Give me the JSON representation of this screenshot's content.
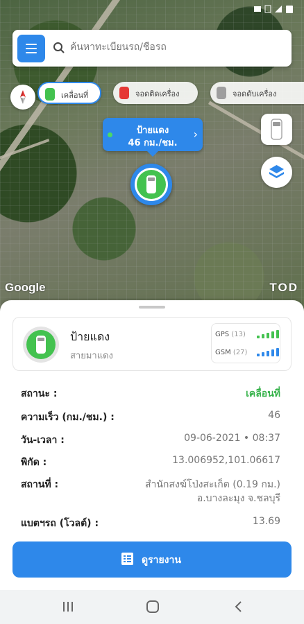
{
  "search": {
    "placeholder": "ค้นหาทะเบียนรถ/ชื่อรถ"
  },
  "filters": [
    {
      "label": "เคลื่อนที่",
      "color": "#43c24f",
      "active": true
    },
    {
      "label": "จอดติดเครื่อง",
      "color": "#e53935",
      "active": false
    },
    {
      "label": "จอดดับเครื่อง",
      "color": "#9e9e9e",
      "active": false
    }
  ],
  "map": {
    "bubble": {
      "name": "ป้ายแดง",
      "speed": "46 กม./ชม."
    },
    "google_logo": "Google",
    "provider_logo": "TOD"
  },
  "vehicle": {
    "name": "ป้ายแดง",
    "line": "สายมาแดง",
    "gps": {
      "label": "GPS",
      "count": "(13)"
    },
    "gsm": {
      "label": "GSM",
      "count": "(27)"
    }
  },
  "details": {
    "status_label": "สถานะ :",
    "status_value": "เคลื่อนที่",
    "speed_label": "ความเร็ว (กม./ชม.) :",
    "speed_value": "46",
    "datetime_label": "วัน-เวลา :",
    "datetime_value": "09-06-2021 • 08:37",
    "coords_label": "พิกัด :",
    "coords_value": "13.006952,101.06617",
    "place_label": "สถานที่ :",
    "place_value_1": "สำนักสงฆ์โป่งสะเก็ต  (0.19 กม.)",
    "place_value_2": "อ.บางละมุง จ.ชลบุรี",
    "battery_label": "แบตฯรถ (โวลต์) :",
    "battery_value": "13.69"
  },
  "report_button": {
    "label": "ดูรายงาน"
  },
  "colors": {
    "accent": "#2e88ea",
    "moving": "#43c24f",
    "gps_bars": "#43c24f",
    "gsm_bars": "#2e88ea"
  }
}
